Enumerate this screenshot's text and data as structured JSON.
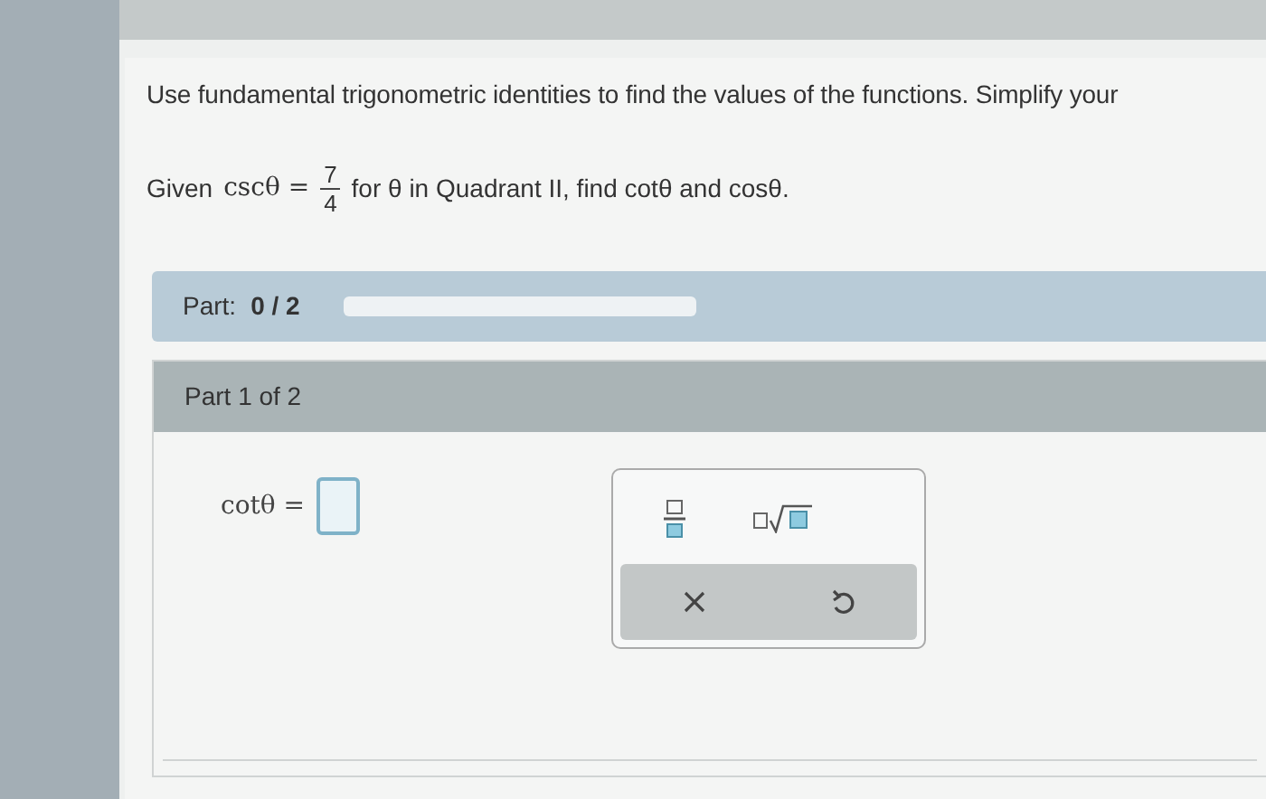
{
  "instruction": "Use fundamental trigonometric identities to find the values of the functions. Simplify your",
  "given": {
    "lead": "Given",
    "lhs": "cscθ =",
    "numerator": "7",
    "denominator": "4",
    "rest": "for θ in Quadrant II, find cotθ and cosθ."
  },
  "progress": {
    "label": "Part:",
    "value": "0 / 2",
    "level": 0
  },
  "part_header": "Part 1 of 2",
  "answer": {
    "label": "cotθ ="
  }
}
